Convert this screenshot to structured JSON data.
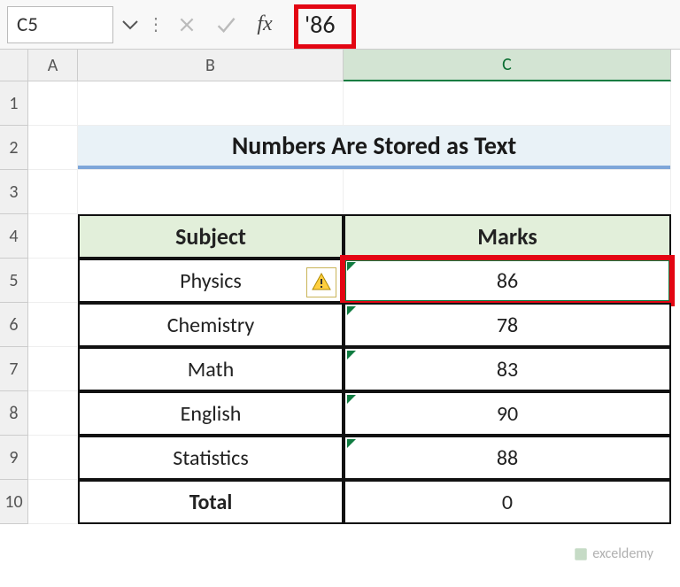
{
  "namebox": {
    "value": "C5"
  },
  "formula": {
    "value": "'86"
  },
  "columns": [
    "",
    "A",
    "B",
    "C"
  ],
  "rows": [
    "1",
    "2",
    "3",
    "4",
    "5",
    "6",
    "7",
    "8",
    "9",
    "10"
  ],
  "title": "Numbers Are Stored as Text",
  "table": {
    "headers": {
      "subject": "Subject",
      "marks": "Marks"
    },
    "rows": [
      {
        "subject": "Physics",
        "marks": "86"
      },
      {
        "subject": "Chemistry",
        "marks": "78"
      },
      {
        "subject": "Math",
        "marks": "83"
      },
      {
        "subject": "English",
        "marks": "90"
      },
      {
        "subject": "Statistics",
        "marks": "88"
      }
    ],
    "total": {
      "label": "Total",
      "value": "0"
    }
  },
  "selected_cell": "C5",
  "watermark": "exceldemy"
}
